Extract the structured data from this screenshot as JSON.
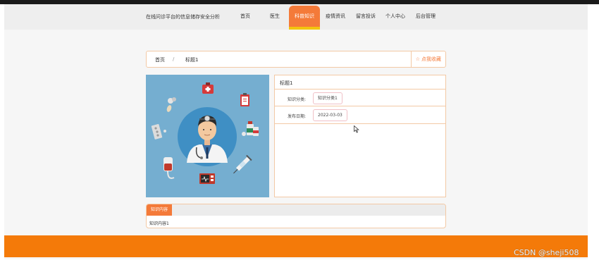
{
  "header": {
    "site_title": "在线问诊平台的信息储存安全分析",
    "nav": [
      {
        "label": "首页",
        "active": false
      },
      {
        "label": "医生",
        "active": false
      },
      {
        "label": "科普知识",
        "active": true
      },
      {
        "label": "疫情资讯",
        "active": false
      },
      {
        "label": "留言投诉",
        "active": false
      },
      {
        "label": "个人中心",
        "active": false
      },
      {
        "label": "后台管理",
        "active": false
      }
    ]
  },
  "breadcrumb": {
    "home": "首页",
    "separator": "/",
    "current": "标题1",
    "collect_label": "点我收藏"
  },
  "hero": {
    "illustration": "doctor-with-medical-icons",
    "background": "#75aed0"
  },
  "info": {
    "title": "标题1",
    "category_label": "知识分类:",
    "category_value": "知识分类1",
    "date_label": "发布日期:",
    "date_value": "2022-03-03"
  },
  "content": {
    "tab_label": "知识内容",
    "text": "知识内容1"
  },
  "footer": {
    "color": "#f47a09"
  },
  "watermark": "CSDN @sheji508",
  "colors": {
    "accent": "#f47a39",
    "active_underline": "#f2c40f",
    "border": "#f3c9a5"
  }
}
